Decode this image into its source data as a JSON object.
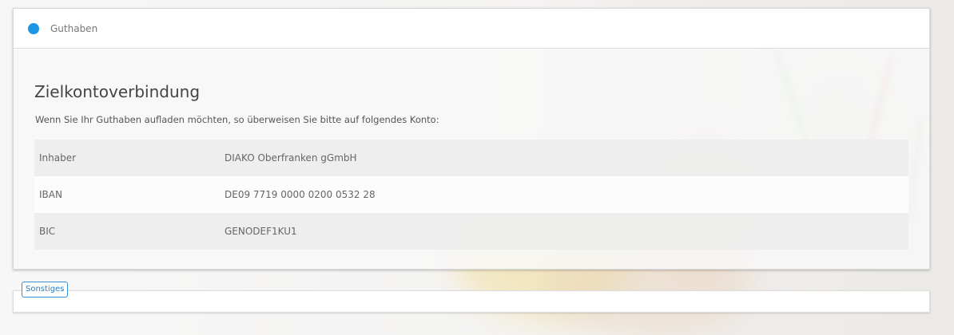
{
  "header": {
    "label": "Guthaben",
    "indicator_color": "#1e96e8"
  },
  "section": {
    "title": "Zielkontoverbindung",
    "intro": "Wenn Sie Ihr Guthaben aufladen möchten, so überweisen Sie bitte auf folgendes Konto:"
  },
  "account": [
    {
      "label": "Inhaber",
      "value": "DIAKO Oberfranken gGmbH"
    },
    {
      "label": "IBAN",
      "value": "DE09 7719 0000 0200 0532 28"
    },
    {
      "label": "BIC",
      "value": "GENODEF1KU1"
    }
  ],
  "other": {
    "button_label": "Sonstiges"
  }
}
